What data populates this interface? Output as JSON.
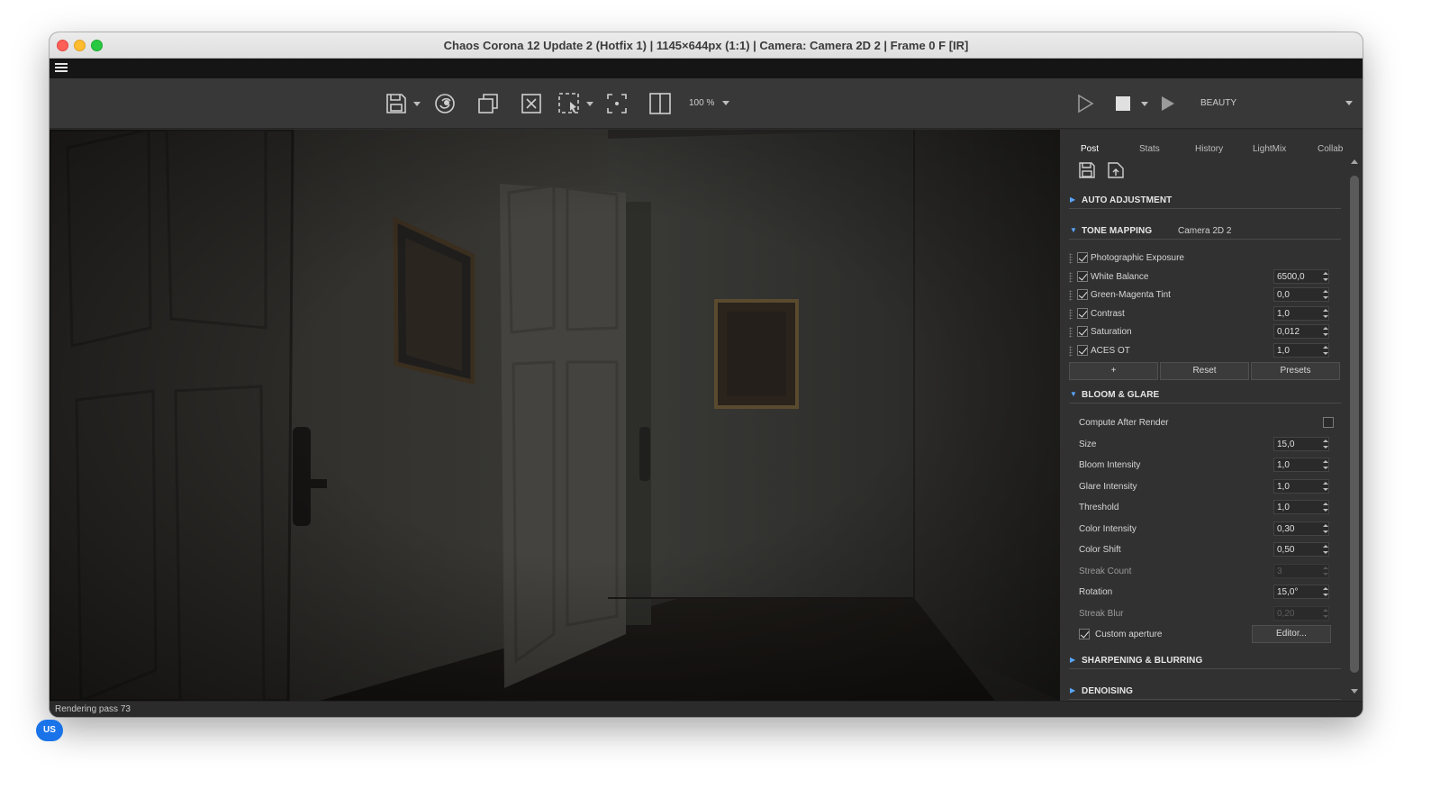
{
  "window": {
    "title": "Chaos Corona 12 Update 2 (Hotfix 1) | 1145×644px (1:1) | Camera: Camera 2D 2 | Frame 0 F [IR]"
  },
  "toolbar": {
    "icons": [
      "save-icon",
      "corona-logo-icon",
      "copy-icon",
      "clear-icon",
      "region-select-icon",
      "focus-icon",
      "compare-icon",
      "render-icon",
      "stop-icon",
      "interactive-render-icon"
    ],
    "zoom": "100 %",
    "render_element": "BEAUTY"
  },
  "tabs": [
    "Post",
    "Stats",
    "History",
    "LightMix",
    "Collab"
  ],
  "active_tab": "Post",
  "sections": {
    "auto_adjustment": {
      "title": "AUTO ADJUSTMENT",
      "enabled": false
    },
    "tone_mapping": {
      "title": "TONE MAPPING",
      "camera": "Camera 2D 2",
      "enabled": true,
      "operators": [
        {
          "label": "Photographic Exposure",
          "checked": true,
          "value": null
        },
        {
          "label": "White Balance",
          "checked": true,
          "value": "6500,0"
        },
        {
          "label": "Green-Magenta Tint",
          "checked": true,
          "value": "0,0"
        },
        {
          "label": "Contrast",
          "checked": true,
          "value": "1,0"
        },
        {
          "label": "Saturation",
          "checked": true,
          "value": "0,012"
        },
        {
          "label": "ACES OT",
          "checked": true,
          "value": "1,0"
        }
      ],
      "buttons": {
        "add": "+",
        "reset": "Reset",
        "presets": "Presets"
      }
    },
    "bloom_glare": {
      "title": "BLOOM & GLARE",
      "enabled": true,
      "compute_after_render": {
        "label": "Compute After Render",
        "checked": false
      },
      "params": [
        {
          "label": "Size",
          "value": "15,0",
          "disabled": false
        },
        {
          "label": "Bloom Intensity",
          "value": "1,0",
          "disabled": false
        },
        {
          "label": "Glare Intensity",
          "value": "1,0",
          "disabled": false
        },
        {
          "label": "Threshold",
          "value": "1,0",
          "disabled": false
        },
        {
          "label": "Color Intensity",
          "value": "0,30",
          "disabled": false
        },
        {
          "label": "Color Shift",
          "value": "0,50",
          "disabled": false
        },
        {
          "label": "Streak Count",
          "value": "3",
          "disabled": true
        },
        {
          "label": "Rotation",
          "value": "15,0°",
          "disabled": false
        },
        {
          "label": "Streak Blur",
          "value": "0,20",
          "disabled": true
        }
      ],
      "custom_aperture": {
        "label": "Custom aperture",
        "checked": true,
        "button": "Editor..."
      }
    },
    "sharpening": {
      "title": "SHARPENING & BLURRING",
      "enabled": false
    },
    "denoising": {
      "title": "DENOISING",
      "enabled": true
    }
  },
  "status": "Rendering pass 73",
  "input_source_badge": "US",
  "colors": {
    "accent": "#5aa6ff",
    "panel": "#313131",
    "toolbar": "#383838"
  }
}
